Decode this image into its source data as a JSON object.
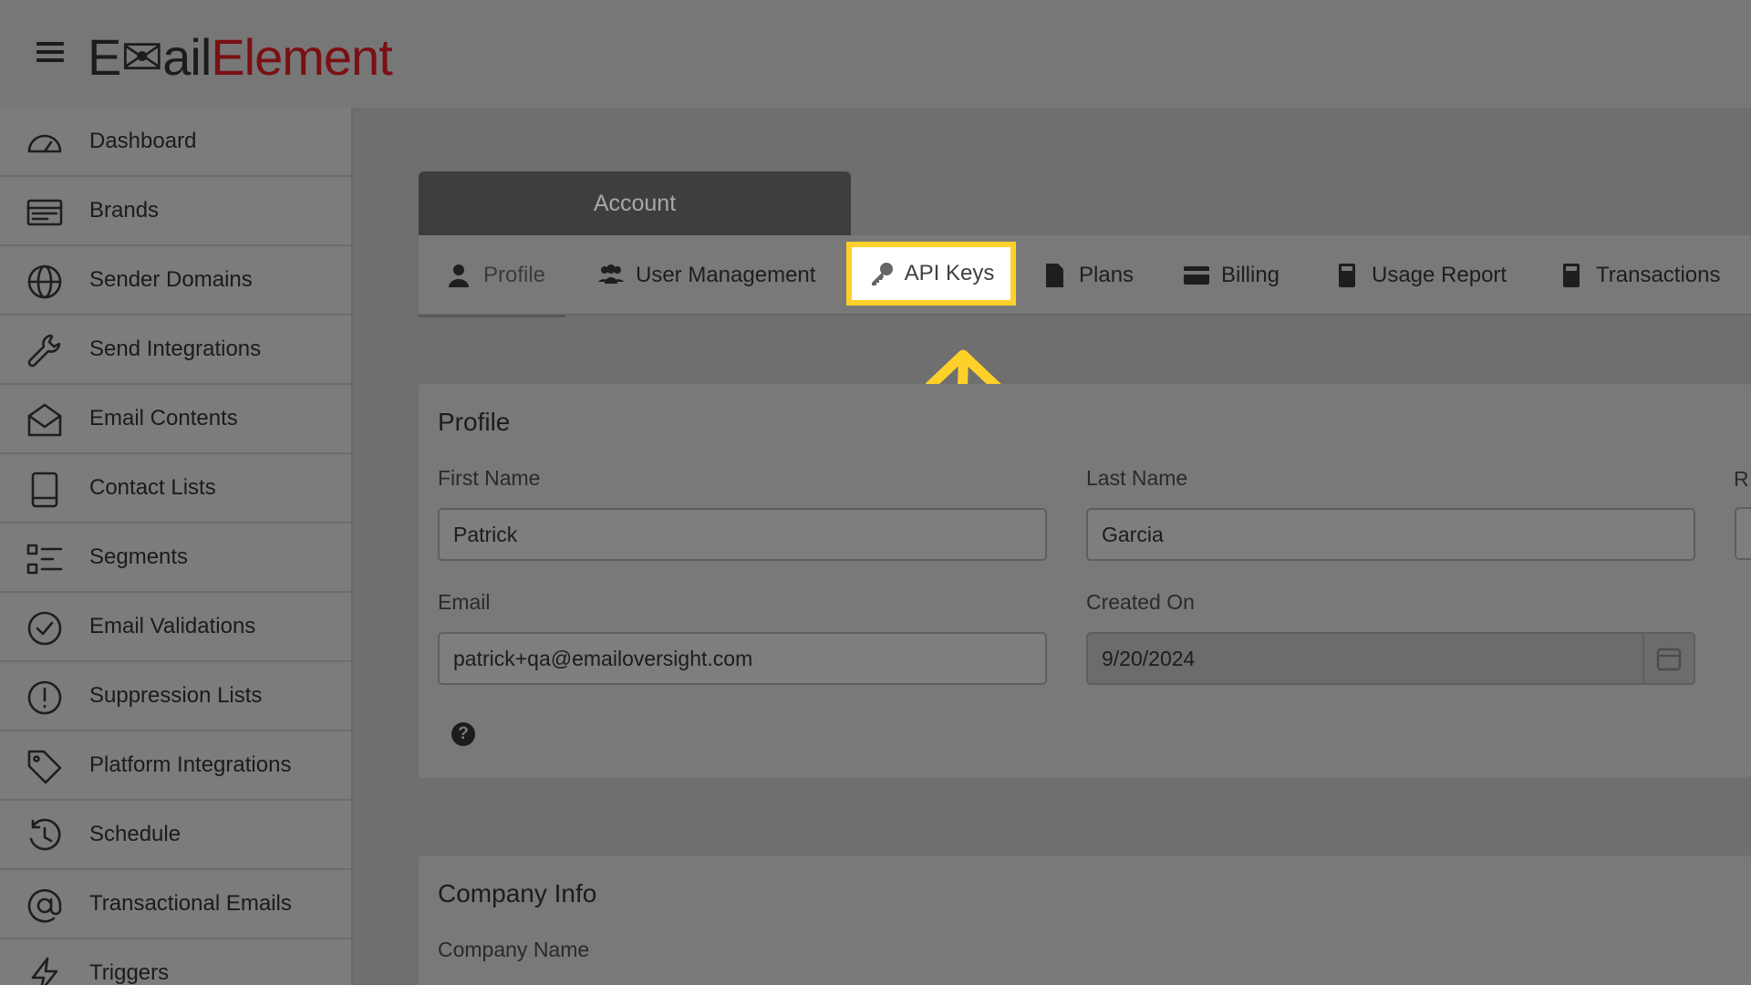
{
  "app": {
    "logo_part1": "E✉ail",
    "logo_part2": "Element"
  },
  "sidebar": {
    "items": [
      {
        "label": "Dashboard"
      },
      {
        "label": "Brands"
      },
      {
        "label": "Sender Domains"
      },
      {
        "label": "Send Integrations"
      },
      {
        "label": "Email Contents"
      },
      {
        "label": "Contact Lists"
      },
      {
        "label": "Segments"
      },
      {
        "label": "Email Validations"
      },
      {
        "label": "Suppression Lists"
      },
      {
        "label": "Platform Integrations"
      },
      {
        "label": "Schedule"
      },
      {
        "label": "Transactional Emails"
      },
      {
        "label": "Triggers"
      }
    ]
  },
  "account": {
    "header": "Account"
  },
  "tabs": {
    "profile": "Profile",
    "user_management": "User Management",
    "api_keys": "API Keys",
    "plans": "Plans",
    "billing": "Billing",
    "usage_report": "Usage Report",
    "transactions": "Transactions"
  },
  "profile": {
    "title": "Profile",
    "first_name_label": "First Name",
    "first_name": "Patrick",
    "last_name_label": "Last Name",
    "last_name": "Garcia",
    "email_label": "Email",
    "email": "patrick+qa@emailoversight.com",
    "created_on_label": "Created On",
    "created_on": "9/20/2024",
    "clipped_label": "R",
    "help": "?"
  },
  "company": {
    "title": "Company Info",
    "company_name_label": "Company Name"
  },
  "colors": {
    "highlight_border": "#ffd02a",
    "arrow": "#ffd02a",
    "logo_accent": "#7a1014"
  }
}
